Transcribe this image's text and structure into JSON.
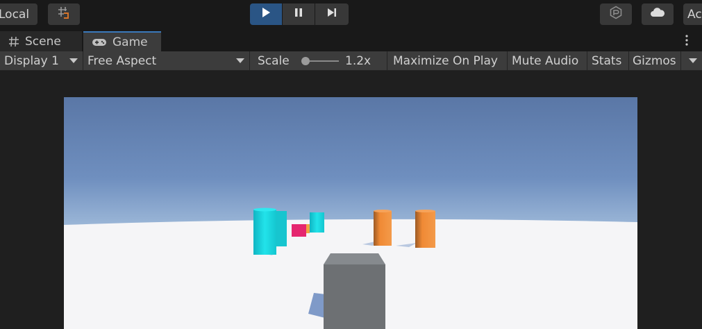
{
  "toolbar": {
    "local_label": "Local",
    "account_label": "Ac",
    "play_icon": "play-icon",
    "pause_icon": "pause-icon",
    "step_icon": "step-icon"
  },
  "tabs": [
    {
      "label": "Scene",
      "icon": "hash-icon"
    },
    {
      "label": "Game",
      "icon": "gamepad-icon"
    }
  ],
  "game_toolbar": {
    "display": "Display 1",
    "aspect": "Free Aspect",
    "scale_label": "Scale",
    "scale_value": "1.2x",
    "maximize": "Maximize On Play",
    "mute": "Mute Audio",
    "stats": "Stats",
    "gizmos": "Gizmos"
  },
  "colors": {
    "play_active": "#2a5585",
    "tab_accent": "#3a79bb",
    "sky_top": "#5a77a6",
    "ground": "#f5f5f7",
    "cyan_obstacle": "#1ad9e0",
    "orange_obstacle": "#f08c3a",
    "pink_obstacle": "#e5266f",
    "player_cube": "#6d7073"
  }
}
